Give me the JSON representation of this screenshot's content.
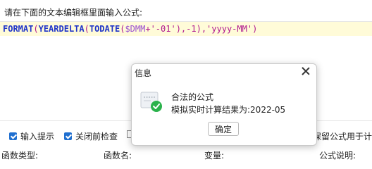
{
  "instruction": "请在下面的文本编辑框里面输入公式:",
  "formula": {
    "parts": [
      {
        "text": "FORMAT",
        "kind": "fn"
      },
      {
        "text": "(",
        "kind": "punc"
      },
      {
        "text": "YEARDELTA",
        "kind": "fn"
      },
      {
        "text": "(",
        "kind": "punc"
      },
      {
        "text": "TODATE",
        "kind": "fn"
      },
      {
        "text": "(",
        "kind": "punc"
      },
      {
        "text": "$DMM",
        "kind": "var"
      },
      {
        "text": "+'-01'),-1),'yyyy-MM')",
        "kind": "str"
      }
    ]
  },
  "options": {
    "input_hint": {
      "label": "输入提示",
      "checked": true
    },
    "check_before_close": {
      "label": "关闭前检查",
      "checked": true
    },
    "keep_formula": {
      "label": "保留公式用于计",
      "checked": false
    }
  },
  "headers": {
    "function_type": "函数类型:",
    "function_name": "函数名:",
    "variable": "变量:",
    "formula_desc": "公式说明:"
  },
  "dialog": {
    "title": "信息",
    "message1": "合法的公式",
    "message2": "模拟实时计算结果为:2022-05",
    "ok_label": "确定"
  }
}
